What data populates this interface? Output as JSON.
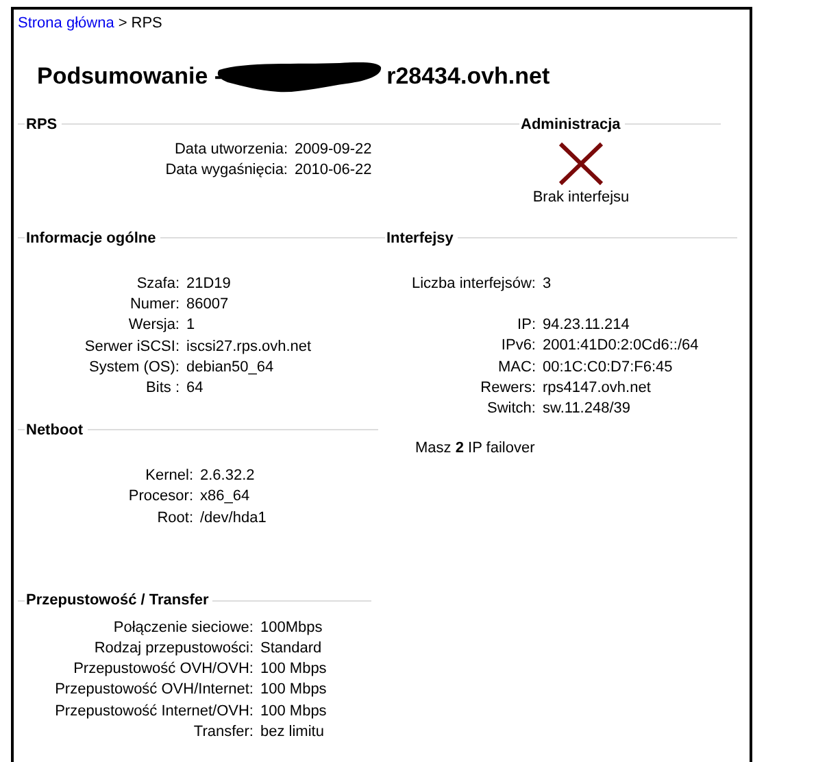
{
  "breadcrumb": {
    "link": "Strona główna",
    "separator": ">",
    "current": "RPS"
  },
  "title": {
    "start": "Podsumowanie -",
    "end": "r28434.ovh.net"
  },
  "rps": {
    "heading": "RPS",
    "rows": [
      {
        "label": "Data utworzenia:",
        "value": "2009-09-22"
      },
      {
        "label": "Data wygaśnięcia:",
        "value": "2010-06-22"
      }
    ]
  },
  "administration": {
    "heading": "Administracja",
    "status": "Brak interfejsu"
  },
  "general": {
    "heading": "Informacje ogólne",
    "rows": [
      {
        "label": "Szafa:",
        "value": "21D19"
      },
      {
        "label": "Numer:",
        "value": "86007"
      },
      {
        "label": "Wersja:",
        "value": "1"
      },
      {
        "label": "Serwer iSCSI:",
        "value": "iscsi27.rps.ovh.net"
      },
      {
        "label": "System (OS):",
        "value": "debian50_64"
      },
      {
        "label": "Bits :",
        "value": "64"
      }
    ]
  },
  "interfaces": {
    "heading": "Interfejsy",
    "count": {
      "label": "Liczba interfejsów:",
      "value": "3"
    },
    "rows": [
      {
        "label": "IP:",
        "value": "94.23.11.214"
      },
      {
        "label": "IPv6:",
        "value": "2001:41D0:2:0Cd6::/64"
      },
      {
        "label": "MAC:",
        "value": "00:1C:C0:D7:F6:45"
      },
      {
        "label": "Rewers:",
        "value": "rps4147.ovh.net"
      },
      {
        "label": "Switch:",
        "value": "sw.11.248/39"
      }
    ],
    "failover": "Masz **2** IP failover"
  },
  "netboot": {
    "heading": "Netboot",
    "rows": [
      {
        "label": "Kernel:",
        "value": "2.6.32.2"
      },
      {
        "label": "Procesor:",
        "value": "x86_64"
      },
      {
        "label": "Root:",
        "value": "/dev/hda1"
      }
    ]
  },
  "bandwidth": {
    "heading": "Przepustowość / Transfer",
    "rows": [
      {
        "label": "Połączenie sieciowe:",
        "value": "100Mbps"
      },
      {
        "label": "Rodzaj przepustowości:",
        "value": "Standard"
      },
      {
        "label": "Przepustowość OVH/OVH:",
        "value": "100 Mbps"
      },
      {
        "label": "Przepustowość OVH/Internet:",
        "value": "100 Mbps"
      },
      {
        "label": "Przepustowość Internet/OVH:",
        "value": "100 Mbps"
      },
      {
        "label": "Transfer:",
        "value": "bez limitu"
      }
    ]
  }
}
